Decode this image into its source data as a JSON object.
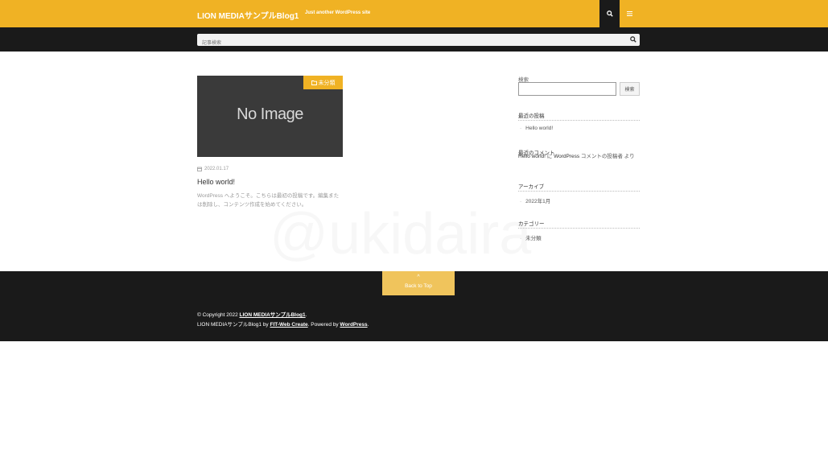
{
  "header": {
    "site_title": "LION MEDIAサンプルBlog1",
    "site_description": "Just another WordPress site",
    "search_icon": "search-icon",
    "menu_icon": "hamburger-icon",
    "accent_color": "#f0b224",
    "dark_color": "#1a1a1a"
  },
  "searchbar": {
    "placeholder": "記事検索",
    "icon": "search-icon"
  },
  "watermark": "@ukidaira",
  "post": {
    "thumbnail_text": "No Image",
    "category": "未分類",
    "category_icon": "folder-icon",
    "date": "2022.01.17",
    "date_icon": "calendar-icon",
    "title": "Hello world!",
    "excerpt": "WordPress へようこそ。こちらは最初の投稿です。編集または削除し、コンテンツ作成を始めてください。"
  },
  "sidebar": {
    "search_label": "検索",
    "search_button": "検索",
    "recent_posts_heading": "最近の投稿",
    "recent_posts": [
      "Hello world!"
    ],
    "recent_comments_heading": "最近のコメント",
    "comment_post": "Hello world!",
    "comment_on": " に ",
    "comment_author": "WordPress",
    "comment_rest": " コメントの投稿者 より",
    "archives_heading": "アーカイブ",
    "archives": [
      "2022年1月"
    ],
    "categories_heading": "カテゴリー",
    "categories": [
      "未分類"
    ]
  },
  "footer": {
    "back_to_top": "Back to Top",
    "copyright_prefix": "© Copyright 2022 ",
    "copyright_link": "LION MEDIAサンプルBlog1",
    "copyright_suffix": ".",
    "credit_prefix": "LION MEDIAサンプルBlog1 by ",
    "credit_link1": "FIT-Web Create",
    "credit_mid": ". Powered by ",
    "credit_link2": "WordPress",
    "credit_suffix": "."
  }
}
